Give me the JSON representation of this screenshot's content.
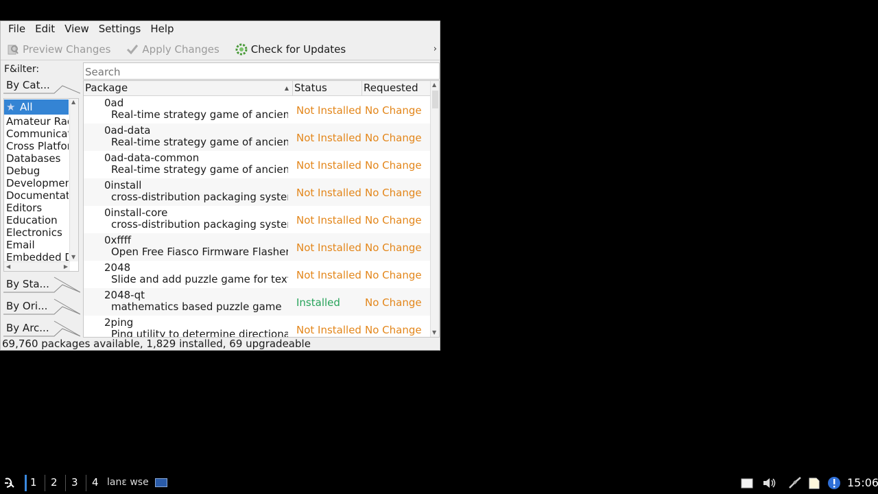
{
  "menubar": {
    "items": [
      "File",
      "Edit",
      "View",
      "Settings",
      "Help"
    ]
  },
  "toolbar": {
    "preview_changes": "Preview Changes",
    "apply_changes": "Apply Changes",
    "check_updates": "Check for Updates",
    "more": "›"
  },
  "filter": {
    "label": "F&ilter:",
    "search_placeholder": "Search"
  },
  "sidebar": {
    "tabs": [
      "By Cat...",
      "By Sta...",
      "By Ori...",
      "By Arc..."
    ],
    "categories": [
      "All",
      "Amateur Radio",
      "Communication",
      "Cross Platform",
      "Databases",
      "Debug",
      "Development",
      "Documentation",
      "Editors",
      "Education",
      "Electronics",
      "Email",
      "Embedded Devices"
    ],
    "selected": "All"
  },
  "table": {
    "headers": {
      "package": "Package",
      "status": "Status",
      "requested": "Requested"
    },
    "rows": [
      {
        "name": "0ad",
        "desc": "Real-time strategy game of ancient warfare",
        "status": "Not Installed",
        "requested": "No Change"
      },
      {
        "name": "0ad-data",
        "desc": "Real-time strategy game of ancient warfare",
        "status": "Not Installed",
        "requested": "No Change"
      },
      {
        "name": "0ad-data-common",
        "desc": "Real-time strategy game of ancient warfare",
        "status": "Not Installed",
        "requested": "No Change"
      },
      {
        "name": "0install",
        "desc": "cross-distribution packaging system",
        "status": "Not Installed",
        "requested": "No Change"
      },
      {
        "name": "0install-core",
        "desc": "cross-distribution packaging system",
        "status": "Not Installed",
        "requested": "No Change"
      },
      {
        "name": "0xffff",
        "desc": "Open Free Fiasco Firmware Flasher",
        "status": "Not Installed",
        "requested": "No Change"
      },
      {
        "name": "2048",
        "desc": "Slide and add puzzle game for text mode",
        "status": "Not Installed",
        "requested": "No Change"
      },
      {
        "name": "2048-qt",
        "desc": "mathematics based puzzle game",
        "status": "Installed",
        "requested": "No Change"
      },
      {
        "name": "2ping",
        "desc": "Ping utility to determine directional packet loss",
        "status": "Not Installed",
        "requested": "No Change"
      }
    ]
  },
  "statusbar": {
    "text": "69,760 packages available, 1,829 installed, 69 upgradeable"
  },
  "taskbar": {
    "desktops": [
      "1",
      "2",
      "3",
      "4"
    ],
    "task_title": "lanɛ wse",
    "clock": "15:06"
  },
  "colors": {
    "not_installed": "#e3861a",
    "installed": "#27a35a",
    "selection": "#3484d4"
  }
}
